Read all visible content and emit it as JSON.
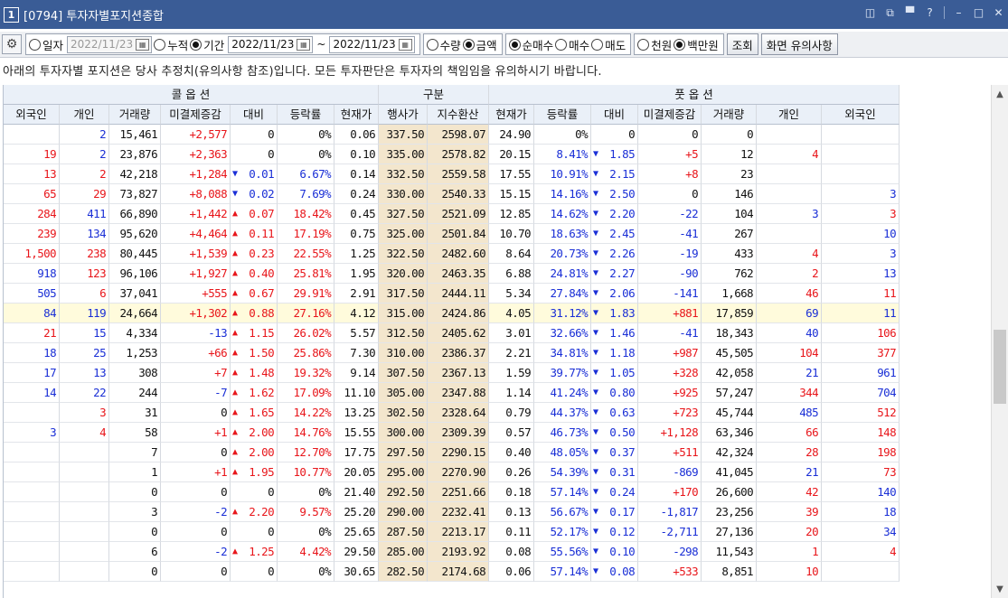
{
  "window": {
    "number": "1",
    "title": "[0794] 투자자별포지션종합"
  },
  "icons": {
    "window_buttons": [
      "layout-icon",
      "restore-icon",
      "pin-icon",
      "help-icon",
      "minimize-icon",
      "maximize-icon",
      "close-icon"
    ],
    "window_glyphs": [
      "◫",
      "⧉",
      "▀",
      "?",
      "–",
      "□",
      "✕"
    ]
  },
  "toolbar": {
    "date_mode": {
      "daily": "일자",
      "daily_date": "2022/11/23",
      "cumulative": "누적",
      "period": "기간",
      "period_from": "2022/11/23",
      "period_sep": "~",
      "period_to": "2022/11/23",
      "selected": "period"
    },
    "unit_type": {
      "qty": "수량",
      "amount": "금액",
      "selected": "amount"
    },
    "trade_type": {
      "net": "순매수",
      "buy": "매수",
      "sell": "매도",
      "selected": "net"
    },
    "money_unit": {
      "thousand": "천원",
      "million": "백만원",
      "selected": "million"
    },
    "query_button": "조회",
    "notice_button": "화면 유의사항"
  },
  "notice": "아래의 투자자별 포지션은 당사 추정치(유의사항 참조)입니다. 모든 투자판단은 투자자의 책임임을 유의하시기 바랍니다.",
  "table": {
    "group_headers": {
      "call": "콜 옵 션",
      "mid": "구분",
      "put": "풋 옵 션"
    },
    "headers": [
      "외국인",
      "개인",
      "거래량",
      "미결제증감",
      "대비",
      "등락률",
      "현재가",
      "행사가",
      "지수환산",
      "현재가",
      "등락률",
      "대비",
      "미결제증감",
      "거래량",
      "개인",
      "외국인"
    ],
    "highlight_row_index": 9,
    "rows": [
      [
        "",
        "2",
        "15,461",
        "+2,577",
        "0",
        "0%",
        "0.06",
        "337.50",
        "2598.07",
        "24.90",
        "0%",
        "0",
        "0",
        "0",
        "",
        ""
      ],
      [
        "19",
        "2",
        "23,876",
        "+2,363",
        "0",
        "0%",
        "0.10",
        "335.00",
        "2578.82",
        "20.15",
        "8.41%",
        "1.85",
        "+5",
        "12",
        "4",
        ""
      ],
      [
        "13",
        "2",
        "42,218",
        "+1,284",
        "0.01",
        "6.67%",
        "0.14",
        "332.50",
        "2559.58",
        "17.55",
        "10.91%",
        "2.15",
        "+8",
        "23",
        "",
        ""
      ],
      [
        "65",
        "29",
        "73,827",
        "+8,088",
        "0.02",
        "7.69%",
        "0.24",
        "330.00",
        "2540.33",
        "15.15",
        "14.16%",
        "2.50",
        "0",
        "146",
        "",
        "3"
      ],
      [
        "284",
        "411",
        "66,890",
        "+1,442",
        "0.07",
        "18.42%",
        "0.45",
        "327.50",
        "2521.09",
        "12.85",
        "14.62%",
        "2.20",
        "-22",
        "104",
        "3",
        "3"
      ],
      [
        "239",
        "134",
        "95,620",
        "+4,464",
        "0.11",
        "17.19%",
        "0.75",
        "325.00",
        "2501.84",
        "10.70",
        "18.63%",
        "2.45",
        "-41",
        "267",
        "",
        "10"
      ],
      [
        "1,500",
        "238",
        "80,445",
        "+1,539",
        "0.23",
        "22.55%",
        "1.25",
        "322.50",
        "2482.60",
        "8.64",
        "20.73%",
        "2.26",
        "-19",
        "433",
        "4",
        "3"
      ],
      [
        "918",
        "123",
        "96,106",
        "+1,927",
        "0.40",
        "25.81%",
        "1.95",
        "320.00",
        "2463.35",
        "6.88",
        "24.81%",
        "2.27",
        "-90",
        "762",
        "2",
        "13"
      ],
      [
        "505",
        "6",
        "37,041",
        "+555",
        "0.67",
        "29.91%",
        "2.91",
        "317.50",
        "2444.11",
        "5.34",
        "27.84%",
        "2.06",
        "-141",
        "1,668",
        "46",
        "11"
      ],
      [
        "84",
        "119",
        "24,664",
        "+1,302",
        "0.88",
        "27.16%",
        "4.12",
        "315.00",
        "2424.86",
        "4.05",
        "31.12%",
        "1.83",
        "+881",
        "17,859",
        "69",
        "11"
      ],
      [
        "21",
        "15",
        "4,334",
        "-13",
        "1.15",
        "26.02%",
        "5.57",
        "312.50",
        "2405.62",
        "3.01",
        "32.66%",
        "1.46",
        "-41",
        "18,343",
        "40",
        "106"
      ],
      [
        "18",
        "25",
        "1,253",
        "+66",
        "1.50",
        "25.86%",
        "7.30",
        "310.00",
        "2386.37",
        "2.21",
        "34.81%",
        "1.18",
        "+987",
        "45,505",
        "104",
        "377"
      ],
      [
        "17",
        "13",
        "308",
        "+7",
        "1.48",
        "19.32%",
        "9.14",
        "307.50",
        "2367.13",
        "1.59",
        "39.77%",
        "1.05",
        "+328",
        "42,058",
        "21",
        "961"
      ],
      [
        "14",
        "22",
        "244",
        "-7",
        "1.62",
        "17.09%",
        "11.10",
        "305.00",
        "2347.88",
        "1.14",
        "41.24%",
        "0.80",
        "+925",
        "57,247",
        "344",
        "704"
      ],
      [
        "",
        "3",
        "31",
        "0",
        "1.65",
        "14.22%",
        "13.25",
        "302.50",
        "2328.64",
        "0.79",
        "44.37%",
        "0.63",
        "+723",
        "45,744",
        "485",
        "512"
      ],
      [
        "3",
        "4",
        "58",
        "+1",
        "2.00",
        "14.76%",
        "15.55",
        "300.00",
        "2309.39",
        "0.57",
        "46.73%",
        "0.50",
        "+1,128",
        "63,346",
        "66",
        "148"
      ],
      [
        "",
        "",
        "7",
        "0",
        "2.00",
        "12.70%",
        "17.75",
        "297.50",
        "2290.15",
        "0.40",
        "48.05%",
        "0.37",
        "+511",
        "42,324",
        "28",
        "198"
      ],
      [
        "",
        "",
        "1",
        "+1",
        "1.95",
        "10.77%",
        "20.05",
        "295.00",
        "2270.90",
        "0.26",
        "54.39%",
        "0.31",
        "-869",
        "41,045",
        "21",
        "73"
      ],
      [
        "",
        "",
        "0",
        "0",
        "0",
        "0%",
        "21.40",
        "292.50",
        "2251.66",
        "0.18",
        "57.14%",
        "0.24",
        "+170",
        "26,600",
        "42",
        "140"
      ],
      [
        "",
        "",
        "3",
        "-2",
        "2.20",
        "9.57%",
        "25.20",
        "290.00",
        "2232.41",
        "0.13",
        "56.67%",
        "0.17",
        "-1,817",
        "23,256",
        "39",
        "18"
      ],
      [
        "",
        "",
        "0",
        "0",
        "0",
        "0%",
        "25.65",
        "287.50",
        "2213.17",
        "0.11",
        "52.17%",
        "0.12",
        "-2,711",
        "27,136",
        "20",
        "34"
      ],
      [
        "",
        "",
        "6",
        "-2",
        "1.25",
        "4.42%",
        "29.50",
        "285.00",
        "2193.92",
        "0.08",
        "55.56%",
        "0.10",
        "-298",
        "11,543",
        "1",
        "4"
      ],
      [
        "",
        "",
        "0",
        "0",
        "0",
        "0%",
        "30.65",
        "282.50",
        "2174.68",
        "0.06",
        "57.14%",
        "0.08",
        "+533",
        "8,851",
        "10",
        ""
      ]
    ],
    "call_dir": [
      "",
      "",
      "down",
      "down",
      "up",
      "up",
      "up",
      "up",
      "up",
      "up",
      "up",
      "up",
      "up",
      "up",
      "up",
      "up",
      "up",
      "up",
      "",
      "up",
      "",
      "up",
      ""
    ],
    "put_dir": [
      "",
      "down",
      "down",
      "down",
      "down",
      "down",
      "down",
      "down",
      "down",
      "down",
      "down",
      "down",
      "down",
      "down",
      "down",
      "down",
      "down",
      "down",
      "down",
      "down",
      "down",
      "down",
      "down"
    ],
    "col_colors": {
      "0": [
        "red",
        "red",
        "red",
        "red",
        "red",
        "red",
        "red",
        "blue",
        "blue",
        "blue",
        "red",
        "blue",
        "blue",
        "blue",
        "",
        "blue",
        "",
        "",
        "",
        "",
        "",
        "",
        ""
      ],
      "1": [
        "blue",
        "blue",
        "red",
        "red",
        "blue",
        "blue",
        "red",
        "red",
        "red",
        "blue",
        "blue",
        "blue",
        "blue",
        "blue",
        "red",
        "red",
        "",
        "",
        "",
        "",
        "",
        "",
        ""
      ],
      "14": [
        "",
        "red",
        "",
        "",
        "blue",
        "",
        "red",
        "red",
        "red",
        "blue",
        "blue",
        "red",
        "blue",
        "red",
        "blue",
        "red",
        "red",
        "blue",
        "red",
        "red",
        "red",
        "red",
        "red"
      ],
      "15": [
        "",
        "",
        "",
        "blue",
        "red",
        "blue",
        "blue",
        "blue",
        "red",
        "blue",
        "red",
        "red",
        "blue",
        "blue",
        "red",
        "red",
        "red",
        "red",
        "blue",
        "blue",
        "blue",
        "red",
        ""
      ]
    }
  }
}
